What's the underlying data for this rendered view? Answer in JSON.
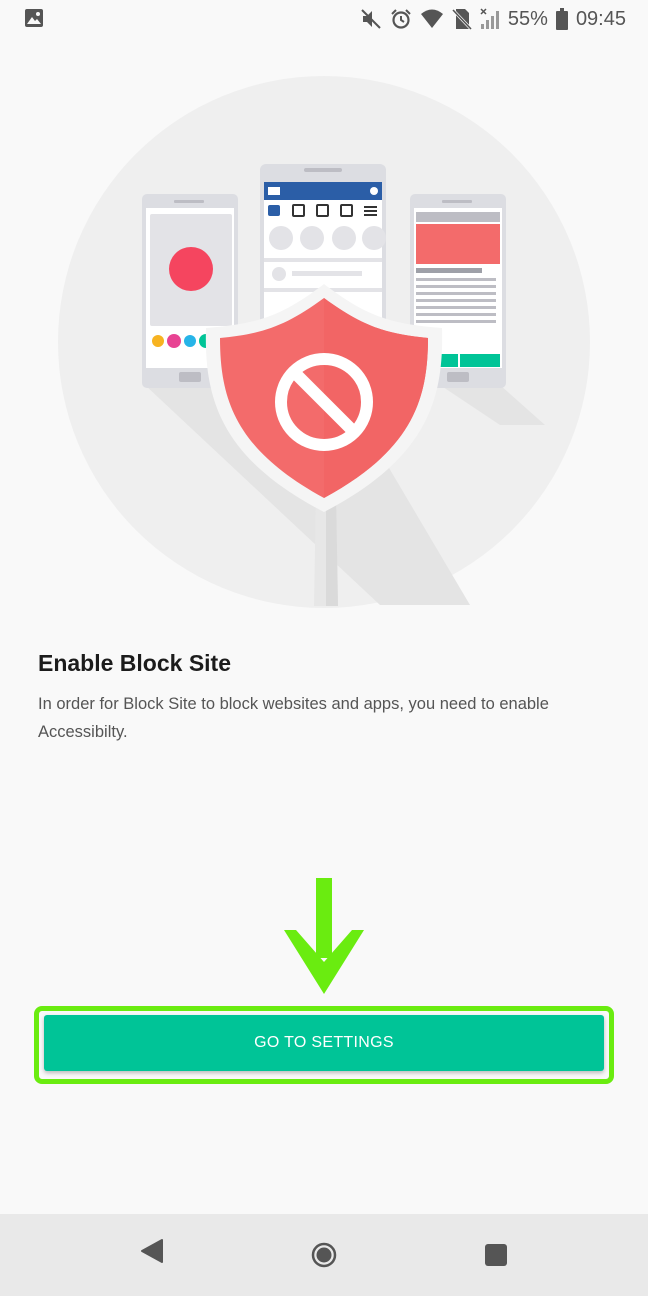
{
  "status_bar": {
    "gallery_icon": "image-icon",
    "icons": [
      "mute-icon",
      "alarm-icon",
      "wifi-icon",
      "no-sim-icon",
      "signal-icon"
    ],
    "battery": "55%",
    "time": "09:45"
  },
  "illustration": {
    "shield_color": "#f36b6b",
    "accent_color": "#00c497",
    "block_icon": "no-entry-icon"
  },
  "main": {
    "title": "Enable Block Site",
    "description": "In order for Block Site to block websites and apps, you need to enable Accessibilty."
  },
  "action": {
    "button_label": "GO TO SETTINGS",
    "highlight_color": "#6aec10"
  },
  "nav_bar": {
    "back": "back-icon",
    "home": "home-icon",
    "recents": "recents-icon"
  }
}
